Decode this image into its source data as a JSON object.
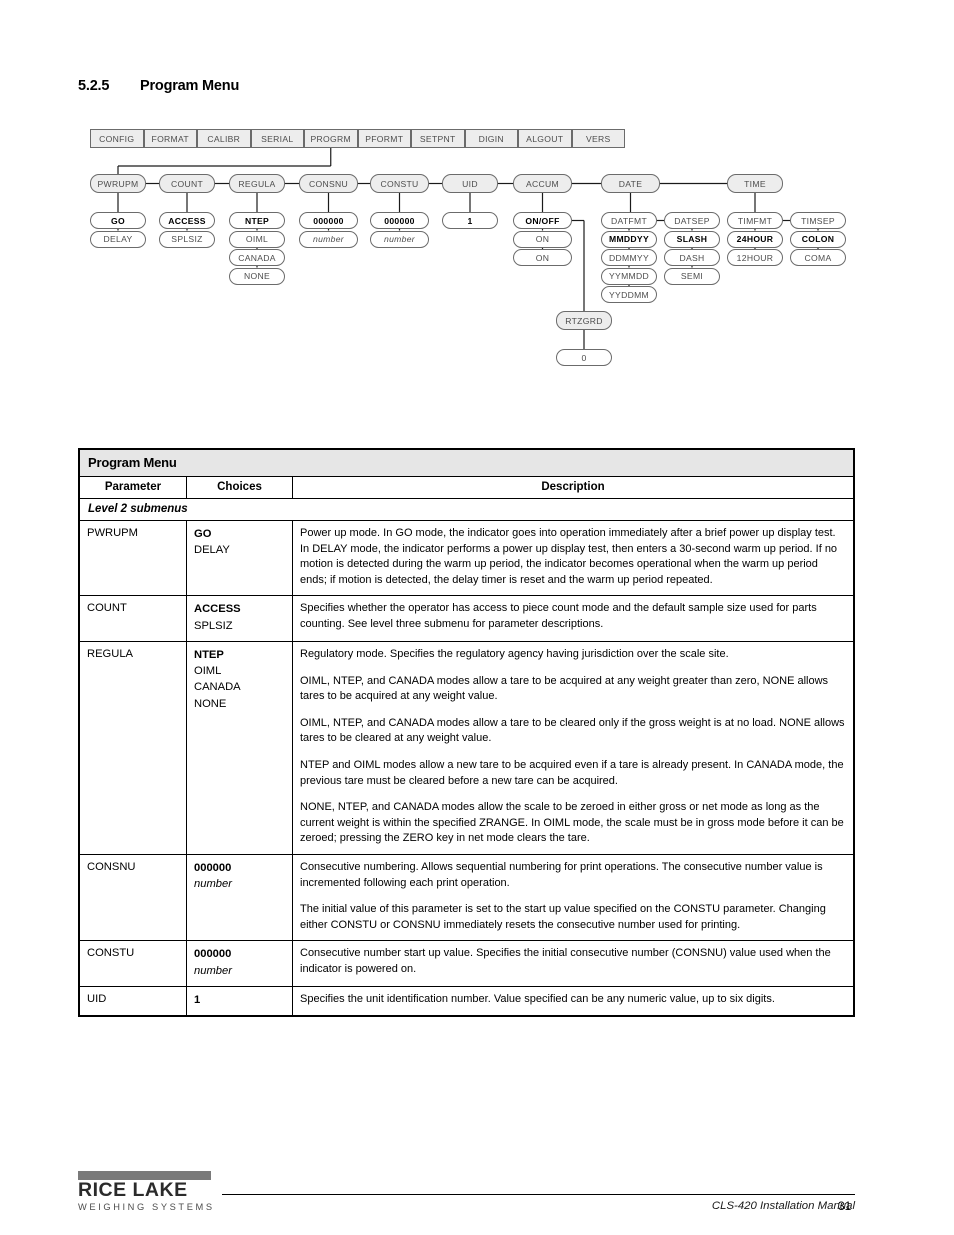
{
  "section": {
    "number": "5.2.5",
    "title": "Program Menu"
  },
  "diagram": {
    "top_menu": [
      "CONFIG",
      "FORMAT",
      "CALIBR",
      "SERIAL",
      "PROGRM",
      "PFORMT",
      "SETPNT",
      "DIGIN",
      "ALGOUT",
      "VERS"
    ],
    "active_menu": "PROGRM",
    "level2": [
      {
        "name": "PWRUPM",
        "choices": [
          {
            "label": "GO",
            "style": "bold"
          },
          {
            "label": "DELAY",
            "style": "plain"
          }
        ]
      },
      {
        "name": "COUNT",
        "choices": [
          {
            "label": "ACCESS",
            "style": "bold"
          },
          {
            "label": "SPLSIZ",
            "style": "plain"
          }
        ]
      },
      {
        "name": "REGULA",
        "choices": [
          {
            "label": "NTEP",
            "style": "bold"
          },
          {
            "label": "OIML",
            "style": "plain"
          },
          {
            "label": "CANADA",
            "style": "plain"
          },
          {
            "label": "NONE",
            "style": "plain"
          }
        ]
      },
      {
        "name": "CONSNU",
        "choices": [
          {
            "label": "000000",
            "style": "bold"
          },
          {
            "label": "number",
            "style": "italic"
          }
        ]
      },
      {
        "name": "CONSTU",
        "choices": [
          {
            "label": "000000",
            "style": "bold"
          },
          {
            "label": "number",
            "style": "italic"
          }
        ]
      },
      {
        "name": "UID",
        "choices": [
          {
            "label": "1",
            "style": "bold"
          }
        ]
      },
      {
        "name": "ACCUM",
        "choices": [
          {
            "label": "ON/OFF",
            "style": "bold"
          },
          {
            "label": "ON",
            "style": "plain"
          },
          {
            "label": "ON",
            "style": "plain"
          }
        ]
      },
      {
        "name": "DATE",
        "choices": []
      },
      {
        "name": "TIME",
        "choices": []
      }
    ],
    "rtzgrd": {
      "name": "RTZGRD",
      "choices": [
        {
          "label": "0",
          "style": "plain"
        }
      ]
    },
    "date_group": [
      {
        "name": "DATFMT",
        "choices": [
          {
            "label": "MMDDYY",
            "style": "bold"
          },
          {
            "label": "DDMMYY",
            "style": "plain"
          },
          {
            "label": "YYMMDD",
            "style": "plain"
          },
          {
            "label": "YYDDMM",
            "style": "plain"
          }
        ]
      },
      {
        "name": "DATSEP",
        "choices": [
          {
            "label": "SLASH",
            "style": "bold"
          },
          {
            "label": "DASH",
            "style": "plain"
          },
          {
            "label": "SEMI",
            "style": "plain"
          }
        ]
      }
    ],
    "time_group": [
      {
        "name": "TIMFMT",
        "choices": [
          {
            "label": "24HOUR",
            "style": "bold"
          },
          {
            "label": "12HOUR",
            "style": "plain"
          }
        ]
      },
      {
        "name": "TIMSEP",
        "choices": [
          {
            "label": "COLON",
            "style": "bold"
          },
          {
            "label": "COMA",
            "style": "plain"
          }
        ]
      }
    ]
  },
  "table": {
    "title": "Program Menu",
    "headers": [
      "Parameter",
      "Choices",
      "Description"
    ],
    "subheader": "Level 2 submenus",
    "rows": [
      {
        "parameter": "PWRUPM",
        "choices": [
          {
            "label": "GO",
            "style": "bold"
          },
          {
            "label": "DELAY",
            "style": "plain"
          }
        ],
        "description": [
          "Power up mode. In GO mode, the indicator goes into operation immediately after a brief power up display test.",
          "In DELAY mode, the indicator performs a power up display test, then enters a 30-second warm up period. If no motion is detected during the warm up period, the indicator becomes operational when the warm up period ends; if motion is detected, the delay timer is reset and the warm up period repeated."
        ],
        "tight": true
      },
      {
        "parameter": "COUNT",
        "choices": [
          {
            "label": "ACCESS",
            "style": "bold"
          },
          {
            "label": "SPLSIZ",
            "style": "plain"
          }
        ],
        "description": [
          "Specifies whether the operator has access to piece count mode and the default sample size used for parts counting. See level three submenu for parameter descriptions."
        ]
      },
      {
        "parameter": "REGULA",
        "choices": [
          {
            "label": "NTEP",
            "style": "bold"
          },
          {
            "label": "OIML",
            "style": "plain"
          },
          {
            "label": "CANADA",
            "style": "plain"
          },
          {
            "label": "NONE",
            "style": "plain"
          }
        ],
        "description": [
          "Regulatory mode. Specifies the regulatory agency having jurisdiction over the scale site.",
          "OIML, NTEP, and CANADA modes allow a tare to be acquired at any weight greater than zero, NONE allows tares to be acquired at any weight value.",
          "OIML, NTEP, and CANADA modes allow a tare to be cleared only if the gross weight is at no load. NONE allows tares to be cleared at any weight value.",
          "NTEP and OIML modes allow a new tare to be acquired even if a tare is already present. In CANADA mode, the previous tare must be cleared before a new tare can be acquired.",
          "NONE, NTEP, and CANADA modes allow the scale to be zeroed in either gross or net mode as long as the current weight is within the specified ZRANGE. In OIML mode, the scale must be in gross mode before it can be zeroed; pressing the ZERO key in net mode clears the tare."
        ]
      },
      {
        "parameter": "CONSNU",
        "choices": [
          {
            "label": "000000",
            "style": "bold"
          },
          {
            "label": "number",
            "style": "italic"
          }
        ],
        "description": [
          "Consecutive numbering. Allows sequential numbering for print operations. The consecutive number value is incremented following each print operation.",
          "The initial value of this parameter is set to the start up value specified on the CONSTU parameter. Changing either CONSTU or CONSNU immediately resets the consecutive number used for printing."
        ]
      },
      {
        "parameter": "CONSTU",
        "choices": [
          {
            "label": "000000",
            "style": "bold"
          },
          {
            "label": "number",
            "style": "italic"
          }
        ],
        "description": [
          "Consecutive number start up value. Specifies the initial consecutive number (CONSNU) value used when the indicator is powered on."
        ]
      },
      {
        "parameter": "UID",
        "choices": [
          {
            "label": "1",
            "style": "bold"
          }
        ],
        "description": [
          "Specifies the unit identification number. Value specified can be any numeric value, up to six digits."
        ]
      }
    ]
  },
  "footer": {
    "logo_main": "RICE LAKE",
    "logo_sub": "WEIGHING SYSTEMS",
    "manual": "CLS-420 Installation Manual",
    "page": "31"
  }
}
